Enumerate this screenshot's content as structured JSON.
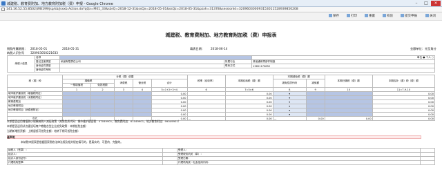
{
  "window": {
    "title": "城建税、教育费附加、地方教育附加税（费）申报 - Google Chrome",
    "url": "141.16.52.55:8502/WB199/jsp/sb/jsxxb.Action.do?qQx=M01_33&sbrQ=2018-12-31&ssQx=2018-05-01&ssQz=2018-05-31&pzxh=31378&sessionId=320960300093153011528939850208"
  },
  "toolbar": {
    "items": [
      "保存",
      "打印",
      "重置",
      "校验",
      "提交申报",
      "关闭"
    ]
  },
  "doc": {
    "title": "城建税、教育费附加、地方教育附加税（费）申报表",
    "period_label": "税款所属期限：",
    "period_from": "2018-05-01",
    "period_to": "2018-05-31",
    "fill_date_label": "填表日期：",
    "fill_date": "2018-06-14",
    "unit_label": "金额单位：元至角分",
    "taxpayer_id_label": "纳税人识别号",
    "taxpayer_id": "320903050221633",
    "taxpayer_info_label": "纳税人信息",
    "fields": {
      "name_label": "名称",
      "name_value": "",
      "type_label": "单位",
      "type2_label": "个人",
      "reg_type_label": "登记注册类型",
      "reg_type_value": "私营有限责任公司",
      "industry_label": "所属行业",
      "industry_value": "其他通用零部件制造",
      "id_type_label": "身份证件类型",
      "id_num_label": "身份证件号码",
      "contact_label": "联系方式",
      "contact_value": "13651170852"
    },
    "table": {
      "h_tax": "税（费）种",
      "h_basis": "计税（费）依据",
      "h_vat": "增值税",
      "h_vat_general": "一般增值税",
      "h_vat_exempt": "免抵税额",
      "h_consumption": "消费税",
      "h_business": "营业税",
      "h_total": "合计",
      "h_rate": "税率（征收率）",
      "h_payable": "本期应纳税（费）额",
      "h_relief": "本期减免税（费）额",
      "h_relief_code": "减免性质代码",
      "h_relief_amt": "减免额",
      "h_paid": "本期已缴税（费）额",
      "h_due": "本期应补（退）税（费）额",
      "col_nums": [
        "1",
        "2",
        "3",
        "4",
        "5=1+2+3+4",
        "6",
        "7=5×6",
        "8",
        "9",
        "10",
        "11=7-9-10"
      ],
      "rows": [
        {
          "name": "城市维护建设税（增值税附征）",
          "v": "0.00",
          "rate": "",
          "pay": "0.00",
          "due": "0.00"
        },
        {
          "name": "城市维护建设税（消费税附征）",
          "v": "0.00",
          "rate": "",
          "pay": "0.00",
          "due": "0.00"
        },
        {
          "name": "教育费附加",
          "v": "0.00",
          "rate": "",
          "pay": "0.00",
          "due": "0.00"
        },
        {
          "name": "地方教育附加",
          "v": "0.00",
          "rate": "",
          "pay": "0.00",
          "due": "0.00"
        },
        {
          "name": "地方教育附加（消费税附征）",
          "v": "0.00",
          "rate": "",
          "pay": "0.00",
          "due": "0.00"
        },
        {
          "name": "",
          "v": "0.00",
          "rate": "",
          "pay": "0.00",
          "due": "0.00"
        }
      ],
      "total_label": "合计",
      "total_vals": [
        "0.00",
        "0.00",
        "0.00",
        "0.00",
        "0.00",
        "0.00",
        "0.00",
        "0.00"
      ]
    },
    "notes": [
      "本期是否适用增值税小规模纳税人减征政策（减免性质代码：城市维护建设税：07049901，教育费附加：61049901，地方教育附加：99049901）",
      "本期是否适用试点建设培育产教融合型企业抵免政策：本期抵免金额：",
      "当期新增投资额：上期留抵可抵免金额：结转下期可抵免金额："
    ],
    "declaration_head": "谨声明",
    "declaration": "本纳税申报表是根据国家税收法律法规及相关规定填写的，是真实的、可靠的、完整的。",
    "sign_labels": [
      "纳税人（签章）：",
      "经办人：",
      "经办人身份证号：",
      "代理机构签章：",
      "代理机构统一社会信用代码：",
      "受理人：",
      "受理税务机关（章）：",
      "受理日期："
    ]
  }
}
